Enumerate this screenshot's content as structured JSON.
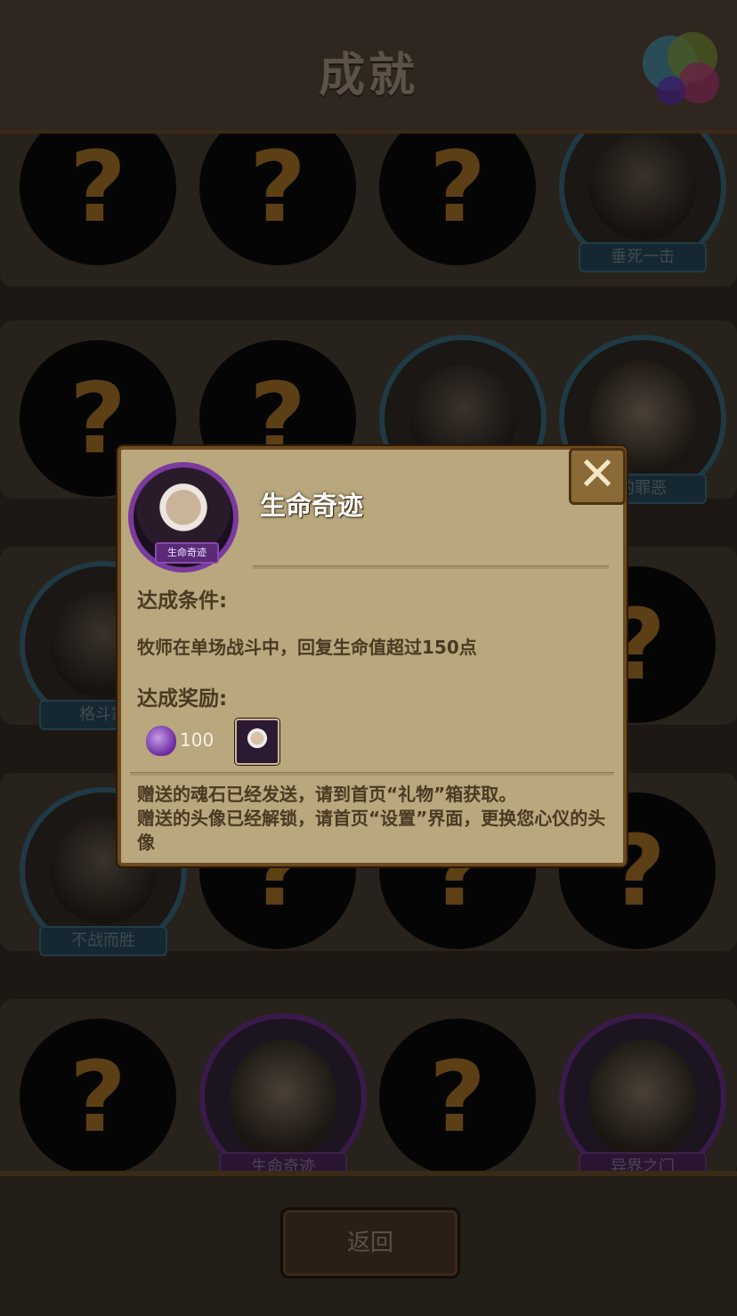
{
  "header": {
    "title": "成就"
  },
  "achievements": {
    "row1": [
      {
        "locked": true
      },
      {
        "locked": true
      },
      {
        "locked": true
      },
      {
        "locked": false,
        "name": "垂死一击"
      }
    ],
    "row2": [
      {
        "locked": true
      },
      {
        "locked": true
      },
      {
        "locked": false
      },
      {
        "locked": false,
        "name": "的罪恶"
      }
    ],
    "row3": [
      {
        "locked": false,
        "name": "格斗家"
      },
      {
        "locked": true
      }
    ],
    "row4": [
      {
        "locked": false,
        "name": "不战而胜"
      },
      {
        "locked": true
      },
      {
        "locked": true
      },
      {
        "locked": true
      }
    ],
    "row5": [
      {
        "locked": true
      },
      {
        "locked": false,
        "name": "生命奇迹"
      },
      {
        "locked": true
      },
      {
        "locked": false,
        "name": "异界之门"
      }
    ],
    "question_mark": "?"
  },
  "dialog": {
    "title": "生命奇迹",
    "avatar_label": "生命奇迹",
    "close_symbol": "✕",
    "condition_label": "达成条件:",
    "condition_text": "牧师在单场战斗中，回复生命值超过150点",
    "reward_label": "达成奖励:",
    "reward_count": "100",
    "note_line1": "赠送的魂石已经发送，请到首页“礼物”箱获取。",
    "note_line2": "赠送的头像已经解锁，请首页“设置”界面，更换您心仪的头像"
  },
  "footer": {
    "back_label": "返回"
  },
  "colors": {
    "dialog_bg": "#b9a77e",
    "dialog_border": "#6f4a1f",
    "dialog_text": "#4a3a22",
    "rare_purple": "#7a3a9e",
    "locked_question": "#5d3f16"
  }
}
